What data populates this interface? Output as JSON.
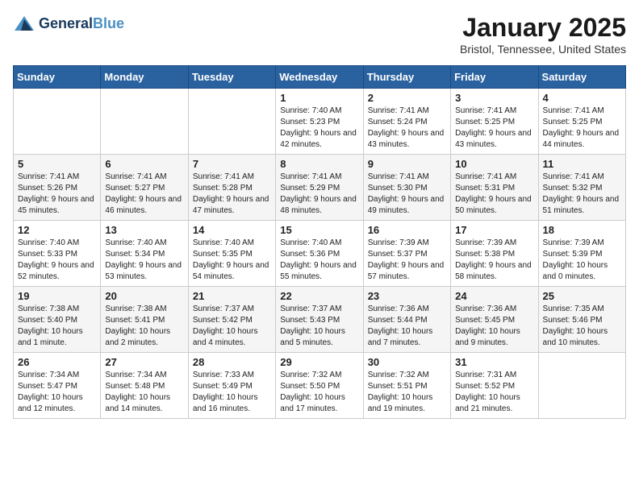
{
  "header": {
    "logo_line1": "General",
    "logo_line2": "Blue",
    "month": "January 2025",
    "location": "Bristol, Tennessee, United States"
  },
  "weekdays": [
    "Sunday",
    "Monday",
    "Tuesday",
    "Wednesday",
    "Thursday",
    "Friday",
    "Saturday"
  ],
  "weeks": [
    [
      {
        "day": "",
        "info": ""
      },
      {
        "day": "",
        "info": ""
      },
      {
        "day": "",
        "info": ""
      },
      {
        "day": "1",
        "info": "Sunrise: 7:40 AM\nSunset: 5:23 PM\nDaylight: 9 hours and 42 minutes."
      },
      {
        "day": "2",
        "info": "Sunrise: 7:41 AM\nSunset: 5:24 PM\nDaylight: 9 hours and 43 minutes."
      },
      {
        "day": "3",
        "info": "Sunrise: 7:41 AM\nSunset: 5:25 PM\nDaylight: 9 hours and 43 minutes."
      },
      {
        "day": "4",
        "info": "Sunrise: 7:41 AM\nSunset: 5:25 PM\nDaylight: 9 hours and 44 minutes."
      }
    ],
    [
      {
        "day": "5",
        "info": "Sunrise: 7:41 AM\nSunset: 5:26 PM\nDaylight: 9 hours and 45 minutes."
      },
      {
        "day": "6",
        "info": "Sunrise: 7:41 AM\nSunset: 5:27 PM\nDaylight: 9 hours and 46 minutes."
      },
      {
        "day": "7",
        "info": "Sunrise: 7:41 AM\nSunset: 5:28 PM\nDaylight: 9 hours and 47 minutes."
      },
      {
        "day": "8",
        "info": "Sunrise: 7:41 AM\nSunset: 5:29 PM\nDaylight: 9 hours and 48 minutes."
      },
      {
        "day": "9",
        "info": "Sunrise: 7:41 AM\nSunset: 5:30 PM\nDaylight: 9 hours and 49 minutes."
      },
      {
        "day": "10",
        "info": "Sunrise: 7:41 AM\nSunset: 5:31 PM\nDaylight: 9 hours and 50 minutes."
      },
      {
        "day": "11",
        "info": "Sunrise: 7:41 AM\nSunset: 5:32 PM\nDaylight: 9 hours and 51 minutes."
      }
    ],
    [
      {
        "day": "12",
        "info": "Sunrise: 7:40 AM\nSunset: 5:33 PM\nDaylight: 9 hours and 52 minutes."
      },
      {
        "day": "13",
        "info": "Sunrise: 7:40 AM\nSunset: 5:34 PM\nDaylight: 9 hours and 53 minutes."
      },
      {
        "day": "14",
        "info": "Sunrise: 7:40 AM\nSunset: 5:35 PM\nDaylight: 9 hours and 54 minutes."
      },
      {
        "day": "15",
        "info": "Sunrise: 7:40 AM\nSunset: 5:36 PM\nDaylight: 9 hours and 55 minutes."
      },
      {
        "day": "16",
        "info": "Sunrise: 7:39 AM\nSunset: 5:37 PM\nDaylight: 9 hours and 57 minutes."
      },
      {
        "day": "17",
        "info": "Sunrise: 7:39 AM\nSunset: 5:38 PM\nDaylight: 9 hours and 58 minutes."
      },
      {
        "day": "18",
        "info": "Sunrise: 7:39 AM\nSunset: 5:39 PM\nDaylight: 10 hours and 0 minutes."
      }
    ],
    [
      {
        "day": "19",
        "info": "Sunrise: 7:38 AM\nSunset: 5:40 PM\nDaylight: 10 hours and 1 minute."
      },
      {
        "day": "20",
        "info": "Sunrise: 7:38 AM\nSunset: 5:41 PM\nDaylight: 10 hours and 2 minutes."
      },
      {
        "day": "21",
        "info": "Sunrise: 7:37 AM\nSunset: 5:42 PM\nDaylight: 10 hours and 4 minutes."
      },
      {
        "day": "22",
        "info": "Sunrise: 7:37 AM\nSunset: 5:43 PM\nDaylight: 10 hours and 5 minutes."
      },
      {
        "day": "23",
        "info": "Sunrise: 7:36 AM\nSunset: 5:44 PM\nDaylight: 10 hours and 7 minutes."
      },
      {
        "day": "24",
        "info": "Sunrise: 7:36 AM\nSunset: 5:45 PM\nDaylight: 10 hours and 9 minutes."
      },
      {
        "day": "25",
        "info": "Sunrise: 7:35 AM\nSunset: 5:46 PM\nDaylight: 10 hours and 10 minutes."
      }
    ],
    [
      {
        "day": "26",
        "info": "Sunrise: 7:34 AM\nSunset: 5:47 PM\nDaylight: 10 hours and 12 minutes."
      },
      {
        "day": "27",
        "info": "Sunrise: 7:34 AM\nSunset: 5:48 PM\nDaylight: 10 hours and 14 minutes."
      },
      {
        "day": "28",
        "info": "Sunrise: 7:33 AM\nSunset: 5:49 PM\nDaylight: 10 hours and 16 minutes."
      },
      {
        "day": "29",
        "info": "Sunrise: 7:32 AM\nSunset: 5:50 PM\nDaylight: 10 hours and 17 minutes."
      },
      {
        "day": "30",
        "info": "Sunrise: 7:32 AM\nSunset: 5:51 PM\nDaylight: 10 hours and 19 minutes."
      },
      {
        "day": "31",
        "info": "Sunrise: 7:31 AM\nSunset: 5:52 PM\nDaylight: 10 hours and 21 minutes."
      },
      {
        "day": "",
        "info": ""
      }
    ]
  ]
}
